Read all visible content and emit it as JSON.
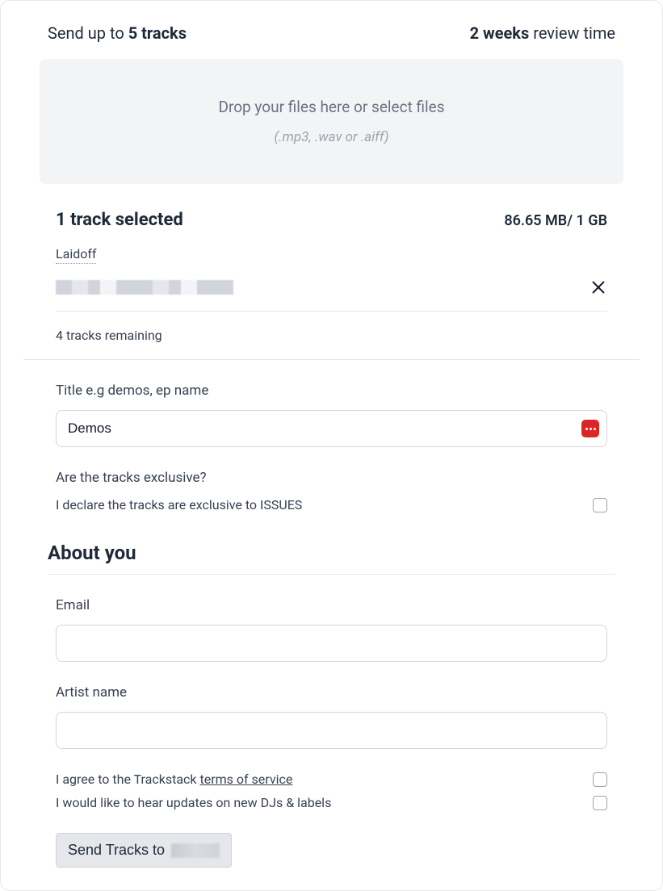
{
  "header": {
    "send_prefix": "Send up to ",
    "max_tracks": "5 tracks",
    "review_time_strong": "2 weeks",
    "review_time_rest": " review time"
  },
  "dropzone": {
    "primary": "Drop your files here or select files",
    "secondary": "(.mp3, .wav or .aiff)"
  },
  "selection": {
    "count_text": "1 track selected",
    "size_text": "86.65 MB/ 1 GB",
    "track_name": "Laidoff",
    "remaining_text": "4 tracks remaining"
  },
  "title_field": {
    "label": "Title e.g demos, ep name",
    "value": "Demos"
  },
  "exclusive": {
    "label": "Are the tracks exclusive?",
    "checkbox_text": "I declare the tracks are exclusive to ISSUES"
  },
  "about": {
    "heading": "About you",
    "email_label": "Email",
    "email_value": "",
    "artist_label": "Artist name",
    "artist_value": ""
  },
  "consent": {
    "terms_prefix": "I agree to the Trackstack ",
    "terms_link": "terms of service",
    "updates_text": "I would like to hear updates on new DJs & labels"
  },
  "submit": {
    "label_prefix": "Send Tracks to "
  }
}
